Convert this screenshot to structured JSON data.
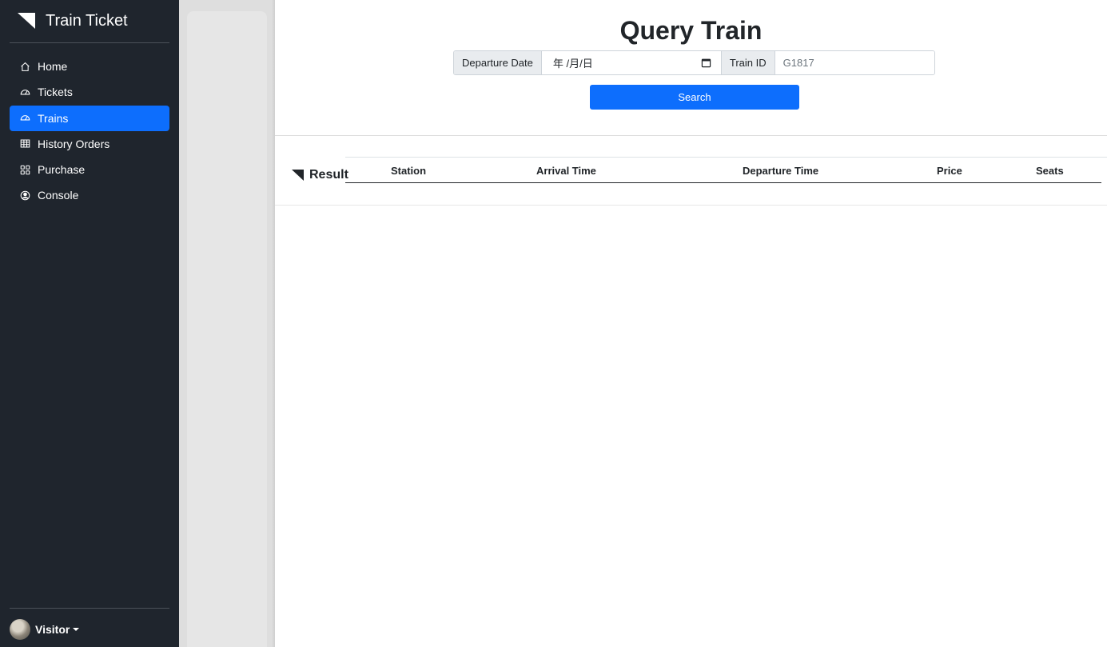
{
  "app": {
    "title": "Train Ticket"
  },
  "sidebar": {
    "items": [
      {
        "label": "Home",
        "icon": "house-icon",
        "active": false
      },
      {
        "label": "Tickets",
        "icon": "speedometer-icon",
        "active": false
      },
      {
        "label": "Trains",
        "icon": "speedometer-icon",
        "active": true
      },
      {
        "label": "History Orders",
        "icon": "table-icon",
        "active": false
      },
      {
        "label": "Purchase",
        "icon": "grid-icon",
        "active": false
      },
      {
        "label": "Console",
        "icon": "person-circle-icon",
        "active": false
      }
    ],
    "user": {
      "name": "Visitor"
    }
  },
  "main": {
    "title": "Query Train",
    "form": {
      "date_label": "Departure Date",
      "date_value": "年 /月/日",
      "train_label": "Train ID",
      "train_placeholder": "G1817",
      "search_label": "Search"
    },
    "result": {
      "label": "Result",
      "columns": [
        "Station",
        "Arrival Time",
        "Departure Time",
        "Price",
        "Seats"
      ]
    }
  },
  "colors": {
    "sidebar_bg": "#1f252d",
    "accent": "#0d6efd",
    "gutter": "#dedede"
  }
}
